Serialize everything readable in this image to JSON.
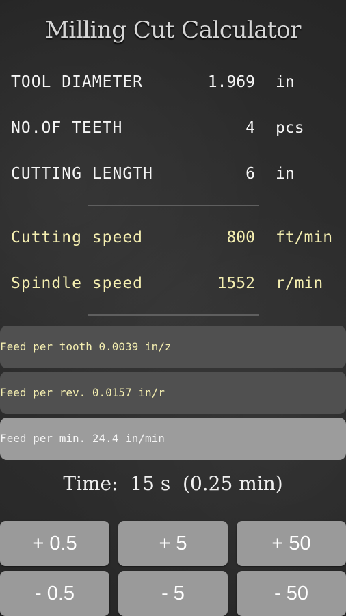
{
  "title": "Milling Cut Calculator",
  "inputs": [
    {
      "label": "TOOL DIAMETER",
      "value": "1.969",
      "unit": "in"
    },
    {
      "label": "NO.OF TEETH",
      "value": "4",
      "unit": "pcs"
    },
    {
      "label": "CUTTING LENGTH",
      "value": "6",
      "unit": "in"
    }
  ],
  "speeds": [
    {
      "label": "Cutting speed",
      "value": "800",
      "unit": "ft/min"
    },
    {
      "label": "Spindle speed",
      "value": "1552",
      "unit": "r/min"
    }
  ],
  "feeds": [
    {
      "label": "Feed per tooth",
      "value": "0.0039",
      "unit": "in/z"
    },
    {
      "label": "Feed per rev.",
      "value": "0.0157",
      "unit": "in/r"
    },
    {
      "label": "Feed per min.",
      "value": "24.4",
      "unit": "in/min"
    }
  ],
  "time": {
    "label": "Time:",
    "seconds": "15 s",
    "minutes": "(0.25 min)"
  },
  "buttons": {
    "plus": [
      "+ 0.5",
      "+ 5",
      "+ 50"
    ],
    "minus": [
      "- 0.5",
      "- 5",
      "- 50"
    ]
  },
  "colors": {
    "label_yellow": "#f4eeb0",
    "button_gray": "#9a9a9a",
    "selected_row": "#9c9c9c"
  }
}
